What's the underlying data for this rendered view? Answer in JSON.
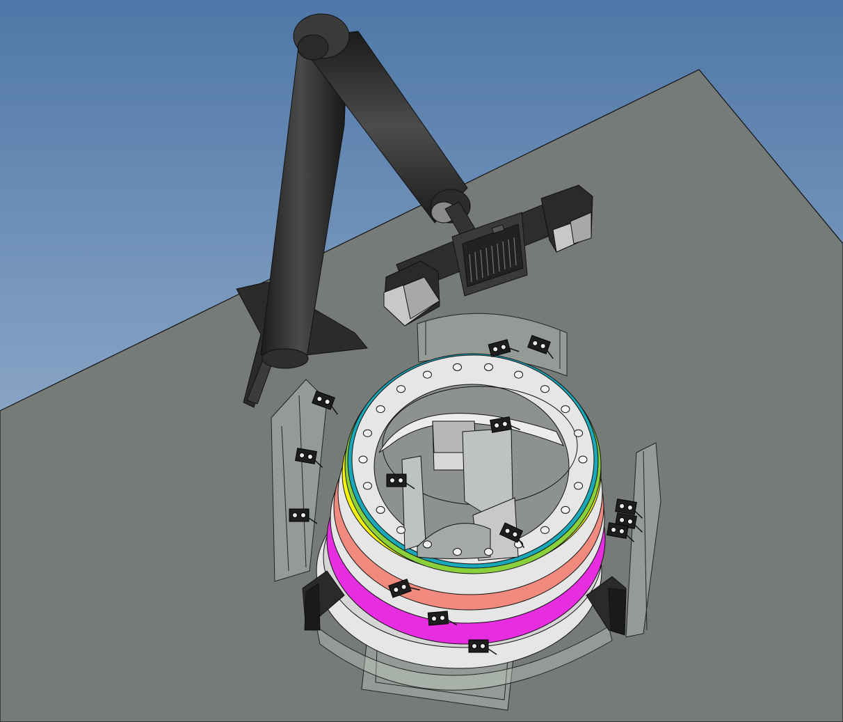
{
  "scene": {
    "kind": "cad-3d-viewport",
    "colors": {
      "background_top": "#4f77a7",
      "background_bottom": "#b3c6dc",
      "floor": "#767b77",
      "robot_arm": "#2b2b2b",
      "end_effector_shell": "#bdbdbd",
      "fixture_ring_white": "#e6e6e6",
      "band_teal": "#1aa7b8",
      "band_green": "#8ad03a",
      "band_yellow": "#f4f20b",
      "band_salmon": "#f08a7e",
      "band_magenta": "#e62ee0",
      "clamp": "#1e1e1e",
      "glass_panel": "#cfd6d2",
      "outline": "#111111"
    },
    "components": [
      {
        "id": "floor-plane",
        "icon": "plane-icon"
      },
      {
        "id": "robot-base",
        "icon": "pedestal-icon"
      },
      {
        "id": "robot-lower-arm",
        "icon": "cylinder-icon"
      },
      {
        "id": "robot-upper-arm",
        "icon": "cylinder-icon"
      },
      {
        "id": "end-effector-gripper",
        "icon": "gripper-icon"
      },
      {
        "id": "ring-workpiece",
        "icon": "ring-icon"
      },
      {
        "id": "transparent-fixture-panels",
        "icon": "panel-icon"
      },
      {
        "id": "sensor-clamps",
        "icon": "clamp-icon"
      }
    ]
  }
}
